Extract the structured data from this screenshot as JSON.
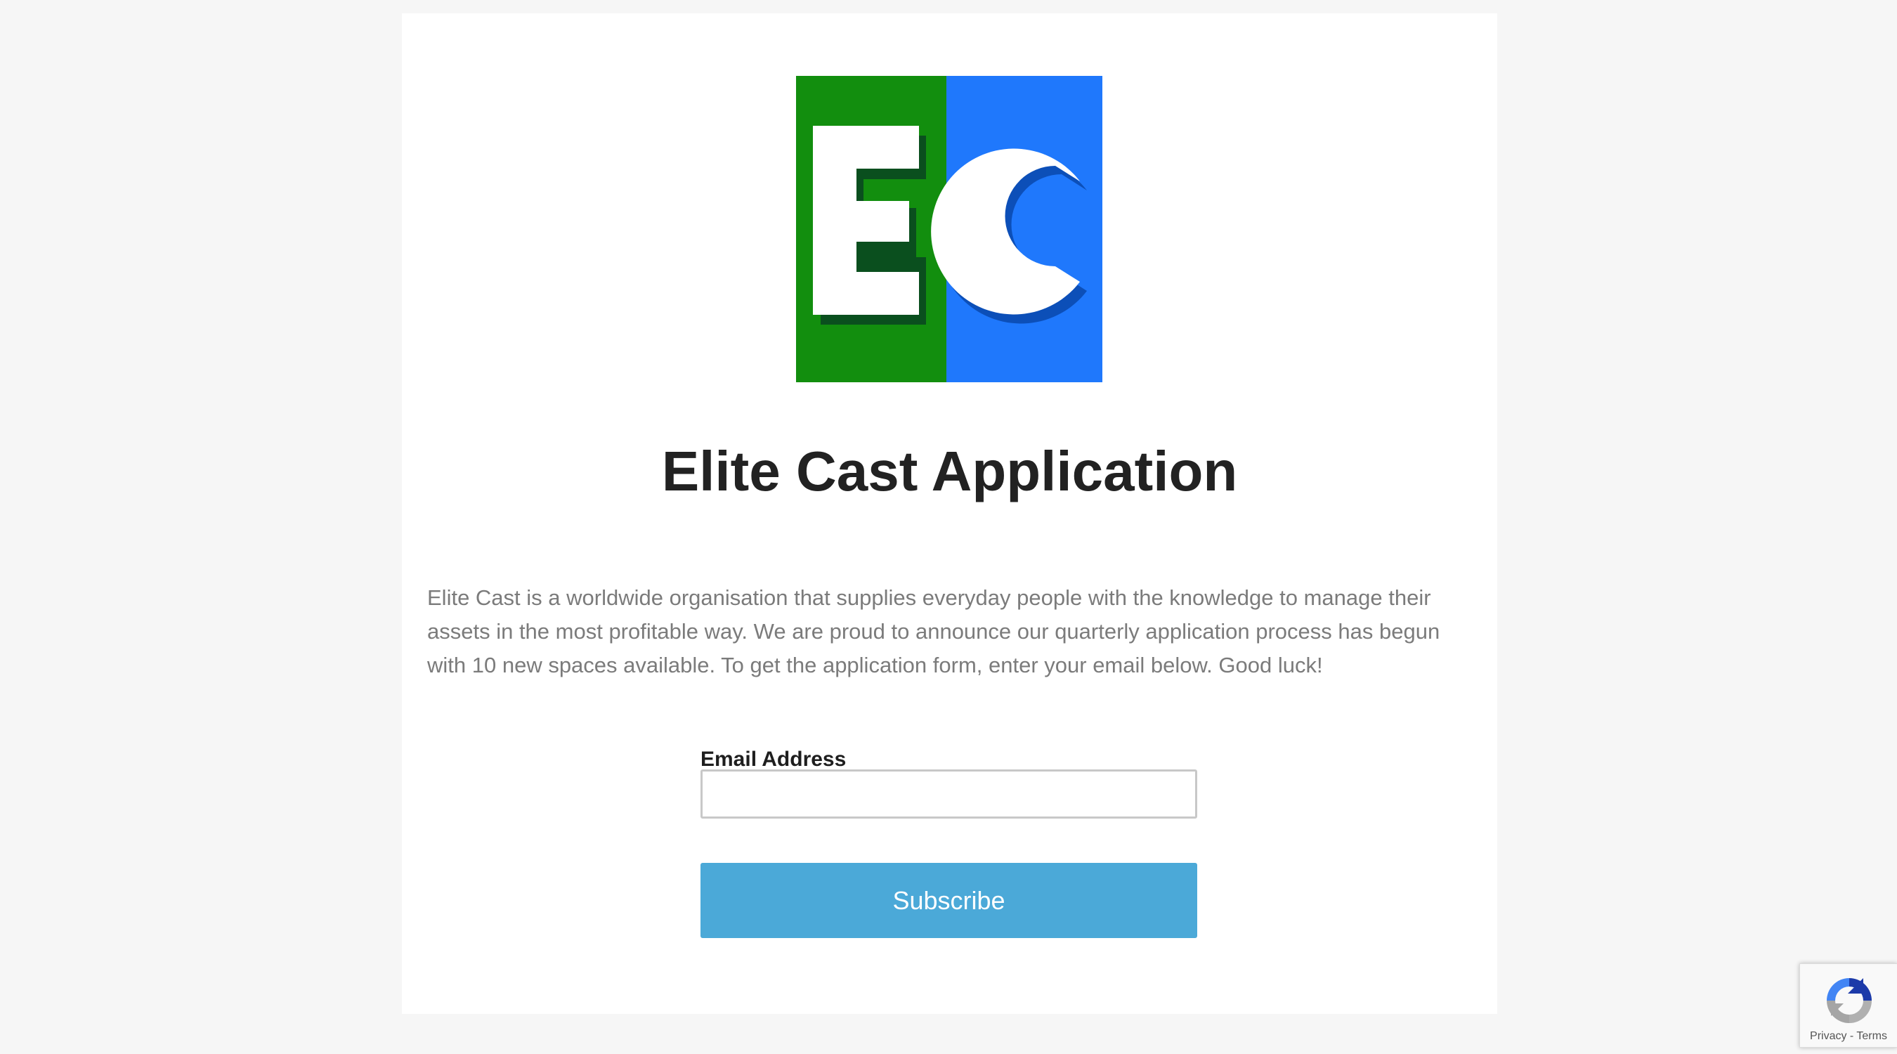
{
  "form": {
    "title": "Elite Cast Application",
    "intro": "Elite Cast is a worldwide organisation that supplies everyday people with the knowledge to manage their assets in the most profitable way. We are proud to announce our quarterly application process has begun with 10 new spaces available. To get the application form, enter your email below. Good luck!",
    "email_label": "Email Address",
    "email_value": "",
    "email_placeholder": "",
    "subscribe_label": "Subscribe"
  },
  "logo": {
    "letters": "EC",
    "icon": "elite-cast-logo",
    "colors": {
      "left_panel": "#128e0e",
      "right_panel": "#1f78fc",
      "letter": "#ffffff",
      "left_shadow": "#0a4f1e",
      "right_shadow": "#0c4fb8"
    }
  },
  "recaptcha": {
    "icon": "recaptcha-icon",
    "privacy_label": "Privacy",
    "separator": "-",
    "terms_label": "Terms"
  },
  "colors": {
    "page_background": "#f6f6f6",
    "card_background": "#ffffff",
    "button": "#4ba9d8",
    "title": "#222222",
    "body_text": "#7b7b7b"
  }
}
